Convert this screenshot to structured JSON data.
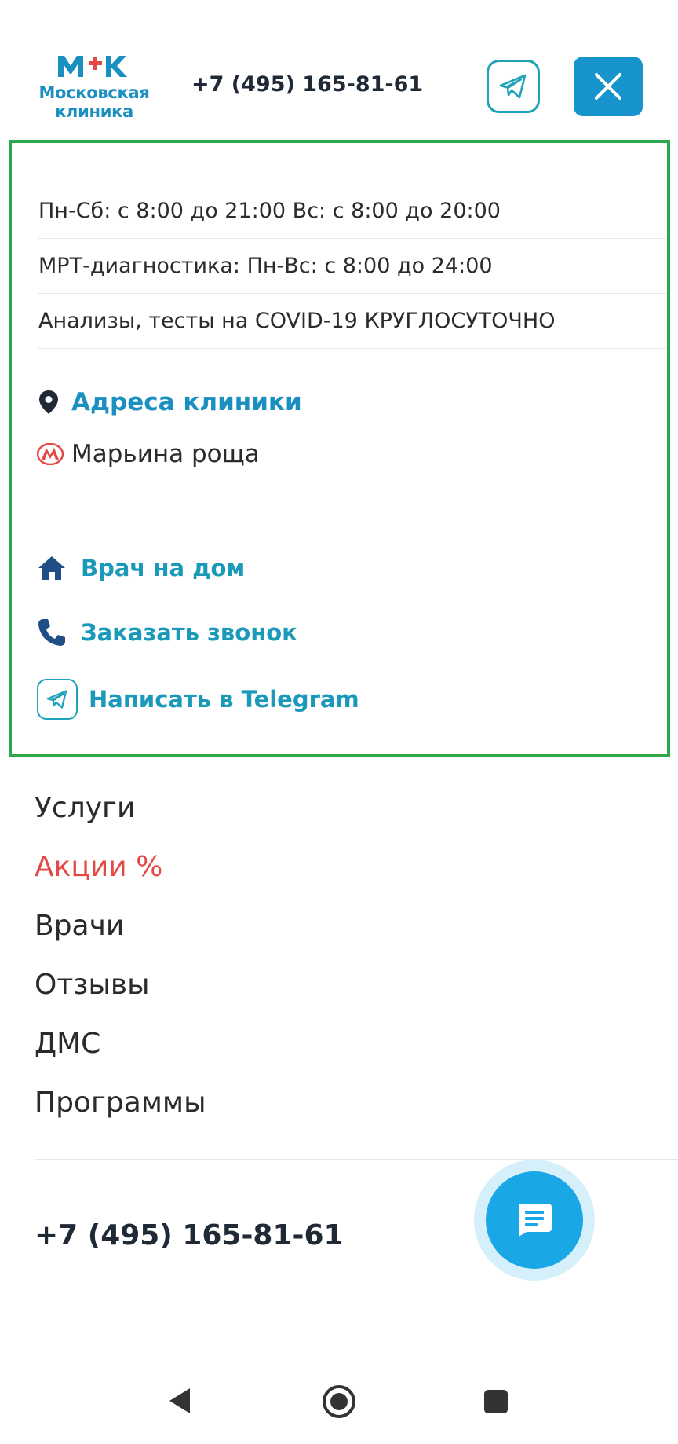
{
  "header": {
    "logo_abbr": "МК",
    "logo_line1": "Московская",
    "logo_line2": "клиника",
    "phone": "+7 (495) 165-81-61"
  },
  "info": {
    "hours": [
      "Пн-Сб: с 8:00 до 21:00 Вс: с 8:00 до 20:00",
      "МРТ-диагностика: Пн-Вс: с 8:00 до 24:00",
      "Анализы, тесты на COVID-19 КРУГЛОСУТОЧНО"
    ],
    "address_link": "Адреса клиники",
    "metro_station": "Марьина роща",
    "actions": {
      "doctor_home": "Врач на дом",
      "order_call": "Заказать звонок",
      "telegram": "Написать в Telegram"
    }
  },
  "menu": {
    "items": [
      "Услуги",
      "Акции %",
      "Врачи",
      "Отзывы",
      "ДМС",
      "Программы"
    ]
  },
  "footer": {
    "phone": "+7 (495) 165-81-61"
  },
  "colors": {
    "brand_blue": "#1894cc",
    "accent_teal": "#1fa3b8",
    "promo_red": "#e34a46",
    "highlight_green": "#2fa84a",
    "fab_blue": "#1aa7e6"
  },
  "icons": {
    "telegram": "telegram-icon",
    "close": "close-icon",
    "location": "location-pin-icon",
    "metro": "metro-icon",
    "home": "house-icon",
    "phone": "phone-icon",
    "chat": "chat-icon",
    "nav_back": "back-triangle-icon",
    "nav_home": "home-circle-icon",
    "nav_recent": "recent-square-icon"
  }
}
